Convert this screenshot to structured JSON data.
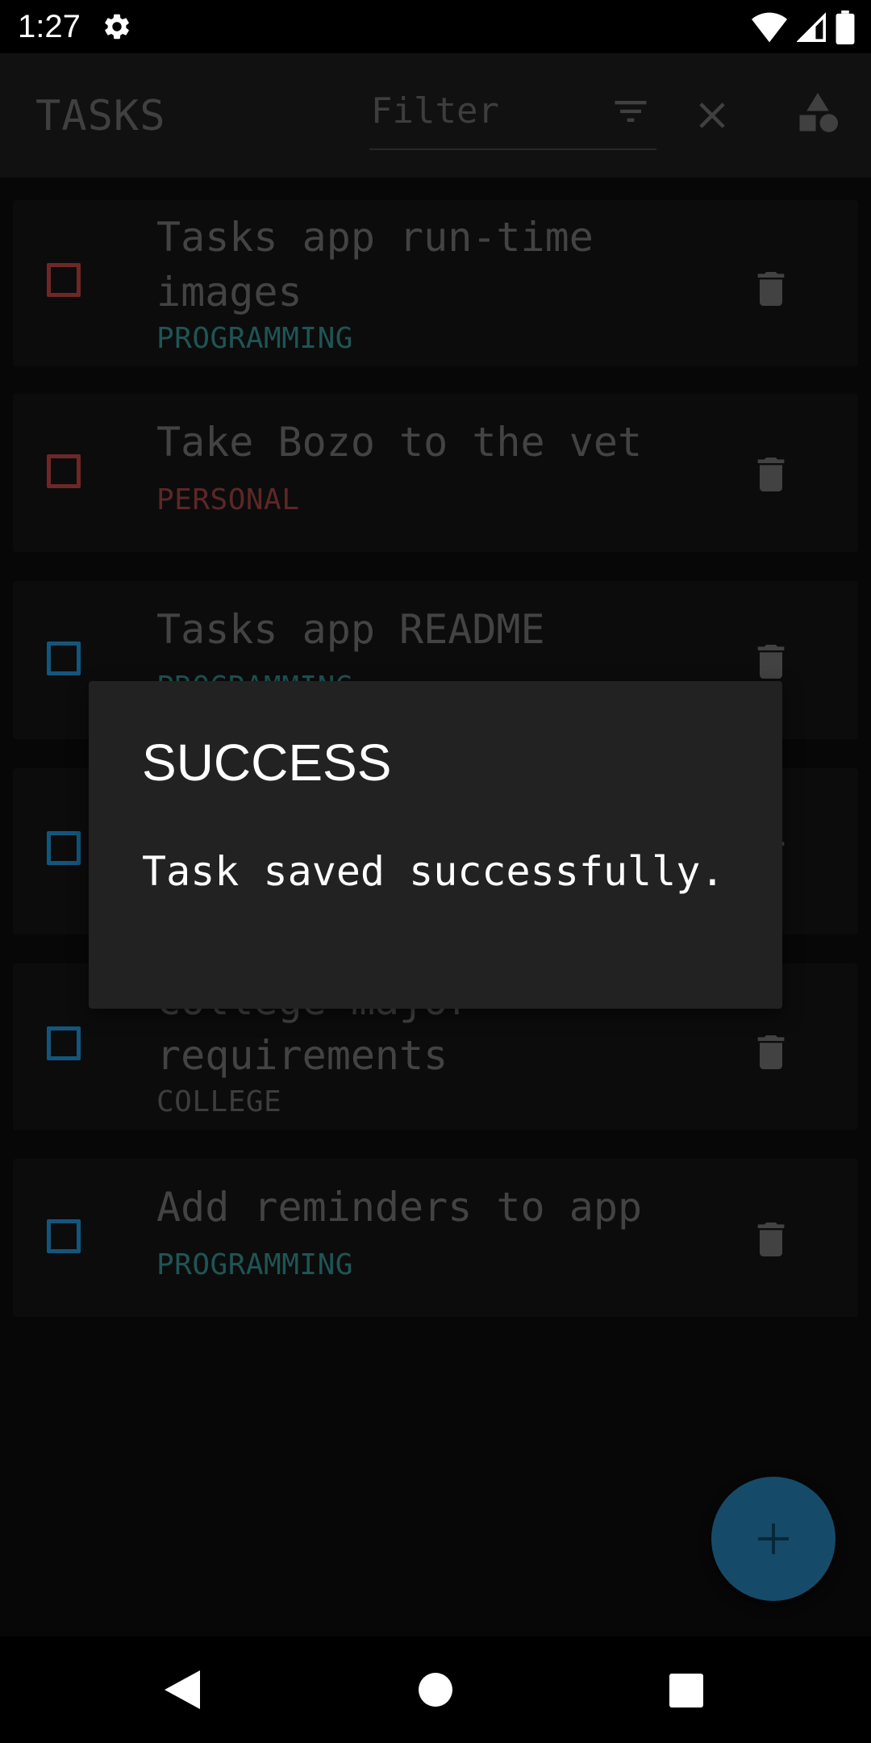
{
  "status_bar": {
    "time": "1:27"
  },
  "app_bar": {
    "title": "TASKS",
    "filter_placeholder": "Filter"
  },
  "tasks": [
    {
      "title": "Tasks app run-time images",
      "category": "PROGRAMMING",
      "checkbox_color": "#a23a3a",
      "category_color": "#2f7d7d"
    },
    {
      "title": "Take Bozo to the vet",
      "category": "PERSONAL",
      "checkbox_color": "#a23a3a",
      "category_color": "#8a3a3a"
    },
    {
      "title": "Tasks app README",
      "category": "PROGRAMMING",
      "checkbox_color": "#1d7fb8",
      "category_color": "#2f7d7d"
    },
    {
      "title": "",
      "category": "",
      "checkbox_color": "#1d7fb8",
      "category_color": "#2f7d7d"
    },
    {
      "title": "College major requirements",
      "category": "COLLEGE",
      "checkbox_color": "#1d7fb8",
      "category_color": "#5a5a5a"
    },
    {
      "title": "Add reminders to app",
      "category": "PROGRAMMING",
      "checkbox_color": "#1d7fb8",
      "category_color": "#2f7d7d"
    }
  ],
  "dialog": {
    "title": "SUCCESS",
    "message": "Task saved successfully."
  },
  "fab": {
    "icon": "plus-icon",
    "color": "#1f6f9b"
  },
  "nav_bar": {
    "icons": [
      "back-icon",
      "home-icon",
      "recents-icon"
    ]
  }
}
